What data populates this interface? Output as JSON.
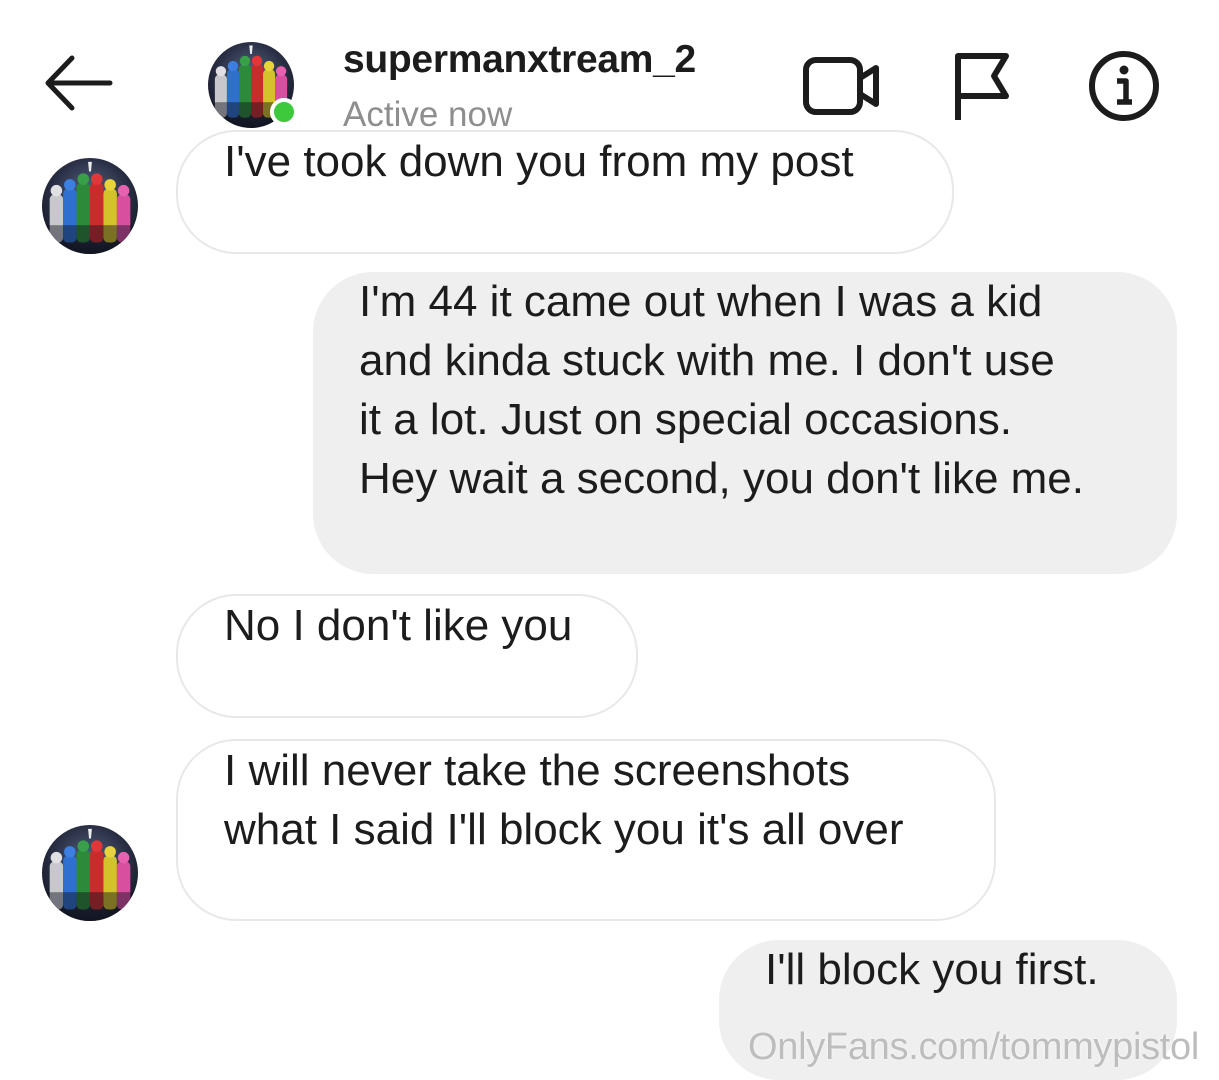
{
  "header": {
    "username": "supermanxtream_2",
    "status": "Active now",
    "icons": {
      "back": "back-arrow-icon",
      "video": "video-call-icon",
      "flag": "flag-icon",
      "info": "info-icon"
    },
    "online_color": "#3cc93c"
  },
  "messages": [
    {
      "direction": "incoming",
      "text": "I've took down you from my post"
    },
    {
      "direction": "outgoing",
      "text": "I'm 44 it came out when I was a kid\nand kinda stuck with me. I don't use\nit a lot. Just on special occasions.\nHey wait a second, you don't like me."
    },
    {
      "direction": "incoming",
      "text": "No I don't like you"
    },
    {
      "direction": "incoming",
      "text": "I will never take the screenshots\nwhat I said I'll block you it's all over"
    },
    {
      "direction": "outgoing",
      "text": "I'll block you first."
    }
  ],
  "watermark": "OnlyFans.com/tommypistol",
  "colors": {
    "incoming_bubble": "#ffffff",
    "outgoing_bubble": "#efefef",
    "secondary_text": "#8e8e8e"
  }
}
